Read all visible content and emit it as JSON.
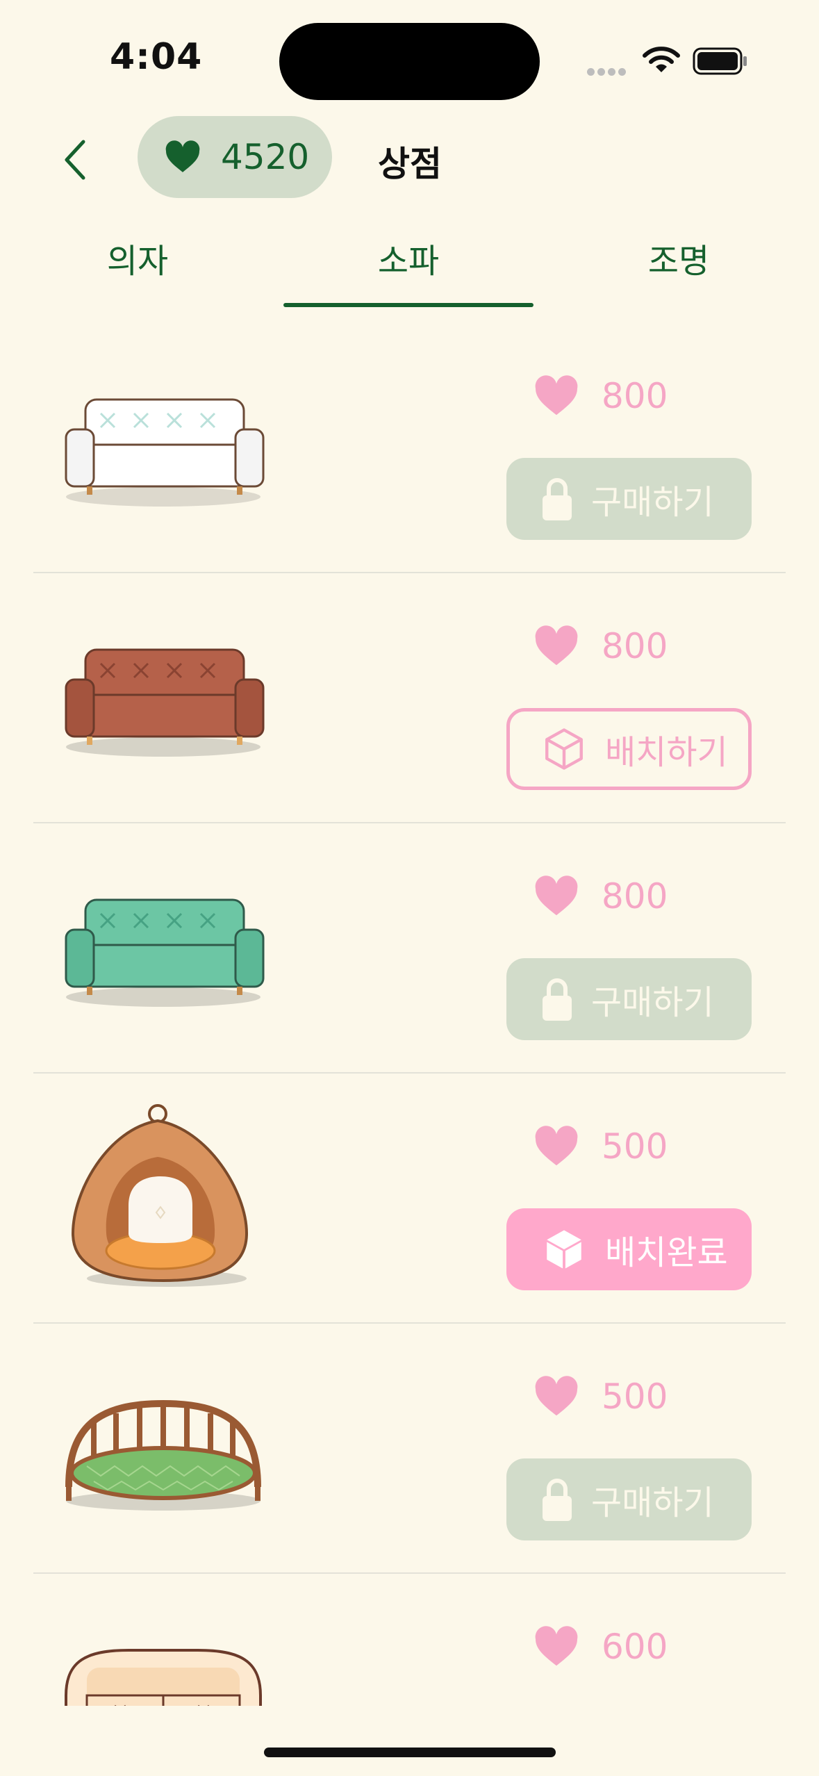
{
  "status_bar": {
    "time": "4:04"
  },
  "header": {
    "heart_count": "4520",
    "title": "상점"
  },
  "tabs": [
    {
      "label": "의자"
    },
    {
      "label": "소파",
      "selected": true
    },
    {
      "label": "조명"
    }
  ],
  "items": [
    {
      "name": "white-sofa",
      "price": "800",
      "button": {
        "state": "locked",
        "label": "구매하기"
      }
    },
    {
      "name": "brown-sofa",
      "price": "800",
      "button": {
        "state": "owned",
        "label": "배치하기"
      }
    },
    {
      "name": "mint-sofa",
      "price": "800",
      "button": {
        "state": "locked",
        "label": "구매하기"
      }
    },
    {
      "name": "rattan-egg-chair",
      "price": "500",
      "button": {
        "state": "placed",
        "label": "배치완료"
      }
    },
    {
      "name": "rattan-round-bed",
      "price": "500",
      "button": {
        "state": "locked",
        "label": "구매하기"
      }
    },
    {
      "name": "cream-sofa",
      "price": "600"
    }
  ],
  "colors": {
    "background": "#fcf8ea",
    "brand_green": "#15602d",
    "pill_green": "#d2dcca",
    "pink": "#f5a6c5",
    "pink_filled": "#ffa8cb"
  },
  "icons": {
    "back": "chevron-left-icon",
    "currency": "heart-icon",
    "locked": "lock-icon",
    "place": "box-icon"
  }
}
